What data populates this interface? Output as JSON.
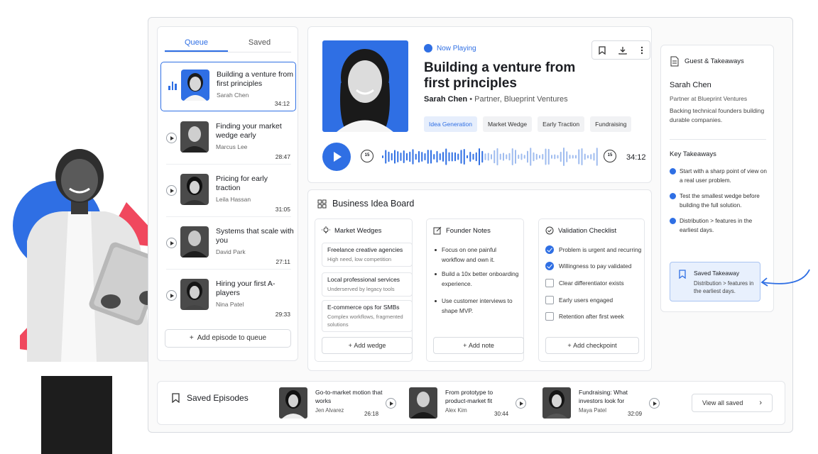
{
  "queue": {
    "tabs": [
      "Queue",
      "Saved"
    ],
    "episodes": [
      {
        "title": "Building a venture from first principles",
        "host": "Sarah Chen",
        "duration": "34:12"
      },
      {
        "title": "Finding your market wedge early",
        "host": "Marcus Lee",
        "duration": "28:47"
      },
      {
        "title": "Pricing for early traction",
        "host": "Leila Hassan",
        "duration": "31:05"
      },
      {
        "title": "Systems that scale with you",
        "host": "David Park",
        "duration": "27:11"
      },
      {
        "title": "Hiring your first A-players",
        "host": "Nina Patel",
        "duration": "29:33"
      }
    ],
    "add_label": "Add episode to queue"
  },
  "now_playing": {
    "status": "Now Playing",
    "title": "Building a venture from first principles",
    "host_name": "Sarah Chen",
    "host_role": "Partner, Blueprint Ventures",
    "tags": [
      "Idea Generation",
      "Market Wedge",
      "Early Traction",
      "Fundraising"
    ],
    "active_tag": "Idea Generation",
    "skip_back": "15",
    "skip_forward": "15",
    "duration": "34:12"
  },
  "board": {
    "title": "Business Idea Board",
    "market_wedges": {
      "title": "Market Wedges",
      "cards": [
        {
          "title": "Freelance creative agencies",
          "subtitle": "High need, low competition"
        },
        {
          "title": "Local professional services",
          "subtitle": "Underserved by legacy tools"
        },
        {
          "title": "E-commerce ops for SMBs",
          "subtitle": "Complex workflows, fragmented solutions"
        }
      ],
      "add_label": "Add wedge"
    },
    "founder_notes": {
      "title": "Founder Notes",
      "notes": [
        "Focus on one painful workflow and own it.",
        "Build a 10x better onboarding experience.",
        "Use customer interviews to shape MVP."
      ],
      "add_label": "Add note"
    },
    "validation": {
      "title": "Validation Checklist",
      "items": [
        {
          "label": "Problem is urgent and recurring",
          "checked": true
        },
        {
          "label": "Willingness to pay validated",
          "checked": true
        },
        {
          "label": "Clear differentiator exists",
          "checked": false
        },
        {
          "label": "Early users engaged",
          "checked": false
        },
        {
          "label": "Retention after first week",
          "checked": false
        }
      ],
      "add_label": "Add checkpoint"
    }
  },
  "guest": {
    "header": "Guest & Takeaways",
    "name": "Sarah Chen",
    "role": "Partner at Blueprint Ventures",
    "bio": "Backing technical founders building durable companies.",
    "takeaways_title": "Key Takeaways",
    "takeaways": [
      "Start with a sharp point of view on a real user problem.",
      "Test the smallest wedge before building the full solution.",
      "Distribution > features in the earliest days."
    ],
    "saved_title": "Saved Takeaway",
    "saved_text": "Distribution > features in the earliest days."
  },
  "saved_bar": {
    "title": "Saved Episodes",
    "items": [
      {
        "title": "Go-to-market motion that works",
        "author": "Jen Alvarez",
        "duration": "26:18"
      },
      {
        "title": "From prototype to product-market fit",
        "author": "Alex Kim",
        "duration": "30:44"
      },
      {
        "title": "Fundraising: What investors look for",
        "author": "Maya Patel",
        "duration": "32:09"
      }
    ],
    "view_all": "View all saved"
  },
  "colors": {
    "accent": "#2f6fe4",
    "coral": "#f0485e"
  }
}
